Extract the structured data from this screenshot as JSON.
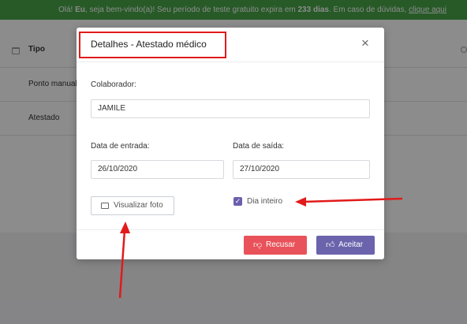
{
  "banner": {
    "greeting": "Olá! ",
    "user": "Eu",
    "message_part": ", seja bem-vindo(a)! Seu período de teste gratuito expira em ",
    "days": "233 dias",
    "message_end": ". Em caso de dúvidas, ",
    "link": "clique aqui"
  },
  "table": {
    "header_tipo": "Tipo",
    "rows": [
      "Ponto manual",
      "Atestado"
    ]
  },
  "modal": {
    "title": "Detalhes - Atestado médico",
    "close_label": "×",
    "collaborator_label": "Colaborador:",
    "collaborator_value": "JAMILE",
    "entry_date_label": "Data de entrada:",
    "entry_date_value": "26/10/2020",
    "exit_date_label": "Data de saída:",
    "exit_date_value": "27/10/2020",
    "view_photo_label": "Visualizar foto",
    "full_day_label": "Dia inteiro",
    "full_day_checked": true,
    "reject_label": "Recusar",
    "accept_label": "Aceitar"
  },
  "colors": {
    "banner": "#47a548",
    "reject": "#e9525a",
    "accept": "#6b63ac",
    "annotation": "#e11b1b"
  },
  "icons": {
    "photo": "image-icon",
    "reject": "thumbs-down-icon",
    "accept": "thumbs-up-icon",
    "close": "close-icon",
    "check": "checkmark-icon"
  }
}
